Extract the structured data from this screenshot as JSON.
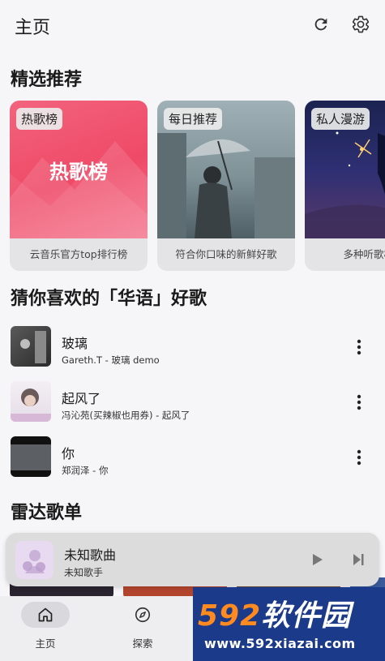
{
  "appbar": {
    "title": "主页",
    "refresh_icon": "refresh-icon",
    "settings_icon": "gear-icon"
  },
  "featured": {
    "title": "精选推荐",
    "cards": [
      {
        "tag": "热歌榜",
        "art_text": "热歌榜",
        "desc": "云音乐官方top排行榜"
      },
      {
        "tag": "每日推荐",
        "desc": "符合你口味的新鲜好歌"
      },
      {
        "tag": "私人漫游",
        "desc": "多种听歌模式"
      }
    ]
  },
  "guess": {
    "title": "猜你喜欢的「华语」好歌",
    "songs": [
      {
        "name": "玻璃",
        "sub": "Gareth.T - 玻璃 demo"
      },
      {
        "name": "起风了",
        "sub": "冯沁苑(买辣椒也用券) - 起风了"
      },
      {
        "name": "你",
        "sub": "郑润泽 - 你"
      }
    ]
  },
  "radar": {
    "title": "雷达歌单"
  },
  "player": {
    "title": "未知歌曲",
    "artist": "未知歌手"
  },
  "nav": {
    "items": [
      {
        "label": "主页",
        "icon": "home-icon",
        "active": true
      },
      {
        "label": "探索",
        "icon": "compass-icon",
        "active": false
      }
    ]
  },
  "watermark": {
    "brand_num": "592",
    "brand_text": "软件园",
    "url": "www.592xiazai.com"
  }
}
